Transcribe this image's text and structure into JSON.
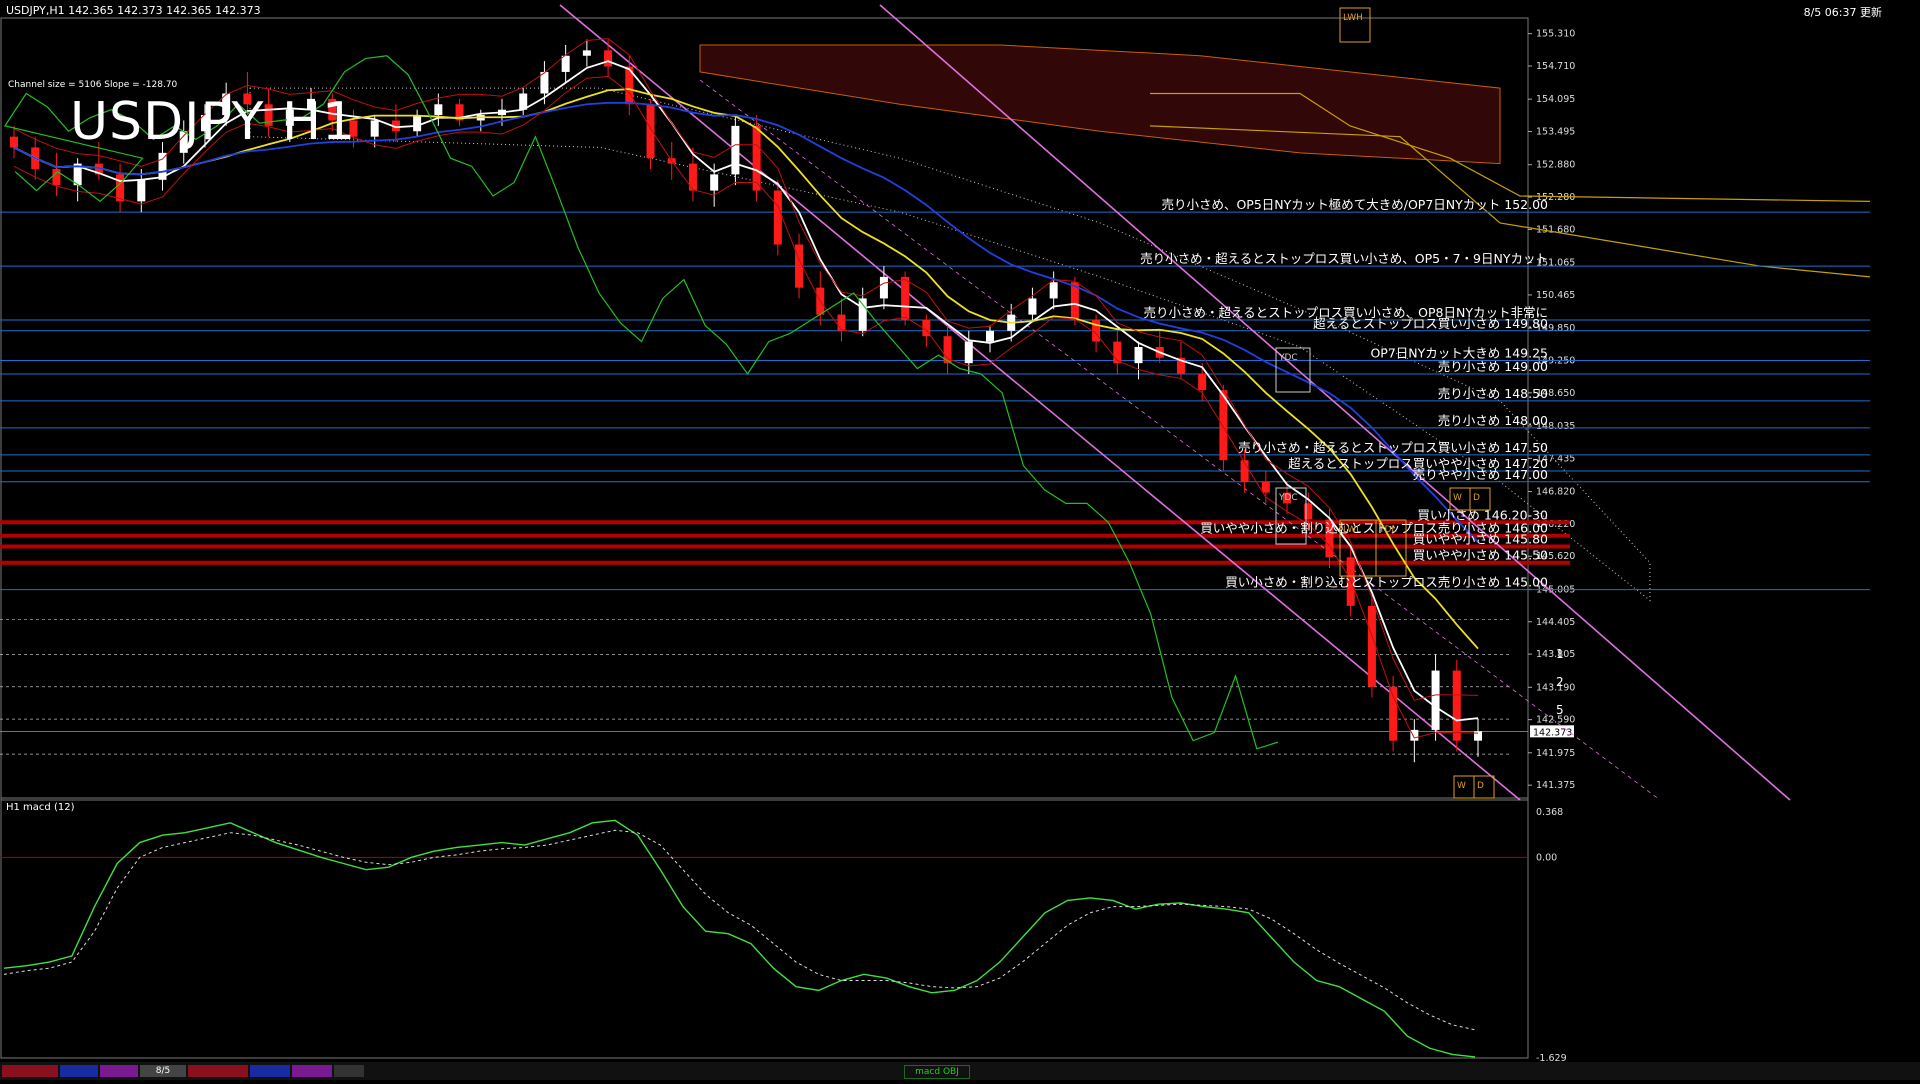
{
  "header": {
    "symbol_info": "USDJPY,H1  142.365 142.373 142.365 142.373",
    "timestamp": "8/5 06:37 更新",
    "channel_info": "Channel size = 5106 Slope = -128.70",
    "big_title": "USDJPY H1",
    "macd_label": "H1  macd (12)",
    "macd_tab": "macd OBJ",
    "date_cell": "8/5"
  },
  "colors": {
    "background": "#000000",
    "up_candle": "#ffffff",
    "down_candle": "#ff1a1a",
    "blue_level": "#1e6fd0",
    "red_zone": "#b40000",
    "channel": "#e070e0",
    "sma_white": "#ffffff",
    "sma_yellow": "#f0e020",
    "sma_blue": "#2040e0",
    "chikou_green": "#22c022",
    "cloud_edge": "#c8a000",
    "macd_green": "#40e040",
    "macd_pink": "#ff8090"
  },
  "chart_data": [
    {
      "type": "candlestick",
      "title": "USDJPY H1",
      "ylim": [
        141.1,
        155.6
      ],
      "y_ticks": [
        "155.310",
        "154.710",
        "154.095",
        "153.495",
        "152.880",
        "152.280",
        "151.680",
        "151.065",
        "150.465",
        "149.850",
        "149.250",
        "148.650",
        "148.035",
        "147.435",
        "146.820",
        "146.220",
        "145.620",
        "145.005",
        "144.405",
        "143.805",
        "143.190",
        "142.590",
        "141.975",
        "141.375"
      ],
      "current_price": "142.373",
      "candles": [
        [
          153.4,
          153.6,
          153.0,
          153.2
        ],
        [
          153.2,
          153.4,
          152.6,
          152.8
        ],
        [
          152.8,
          153.1,
          152.3,
          152.5
        ],
        [
          152.5,
          153.0,
          152.2,
          152.9
        ],
        [
          152.9,
          153.3,
          152.6,
          152.7
        ],
        [
          152.7,
          152.9,
          152.0,
          152.2
        ],
        [
          152.2,
          152.8,
          152.0,
          152.6
        ],
        [
          152.6,
          153.3,
          152.4,
          153.1
        ],
        [
          153.1,
          153.7,
          152.9,
          153.5
        ],
        [
          153.5,
          154.0,
          153.2,
          153.8
        ],
        [
          153.8,
          154.4,
          153.6,
          154.2
        ],
        [
          154.2,
          154.6,
          153.8,
          154.0
        ],
        [
          154.0,
          154.3,
          153.4,
          153.6
        ],
        [
          153.6,
          154.0,
          153.3,
          153.9
        ],
        [
          153.9,
          154.3,
          153.7,
          154.1
        ],
        [
          154.1,
          154.2,
          153.5,
          153.7
        ],
        [
          153.7,
          153.9,
          153.2,
          153.4
        ],
        [
          153.4,
          153.8,
          153.2,
          153.7
        ],
        [
          153.7,
          154.0,
          153.3,
          153.5
        ],
        [
          153.5,
          153.9,
          153.4,
          153.8
        ],
        [
          153.8,
          154.2,
          153.6,
          154.0
        ],
        [
          154.0,
          154.1,
          153.6,
          153.7
        ],
        [
          153.7,
          153.9,
          153.5,
          153.8
        ],
        [
          153.8,
          154.1,
          153.6,
          153.9
        ],
        [
          153.9,
          154.3,
          153.8,
          154.2
        ],
        [
          154.2,
          154.8,
          154.0,
          154.6
        ],
        [
          154.6,
          155.1,
          154.4,
          154.9
        ],
        [
          154.9,
          155.2,
          154.7,
          155.0
        ],
        [
          155.0,
          155.2,
          154.5,
          154.7
        ],
        [
          154.7,
          154.9,
          153.8,
          154.0
        ],
        [
          154.0,
          154.1,
          152.8,
          153.0
        ],
        [
          153.0,
          153.3,
          152.6,
          152.9
        ],
        [
          152.9,
          153.2,
          152.2,
          152.4
        ],
        [
          152.4,
          152.9,
          152.1,
          152.7
        ],
        [
          152.7,
          153.8,
          152.5,
          153.6
        ],
        [
          153.6,
          153.8,
          152.2,
          152.4
        ],
        [
          152.4,
          152.6,
          151.2,
          151.4
        ],
        [
          151.4,
          151.6,
          150.4,
          150.6
        ],
        [
          150.6,
          150.9,
          149.9,
          150.1
        ],
        [
          150.1,
          150.4,
          149.6,
          149.8
        ],
        [
          149.8,
          150.6,
          149.7,
          150.4
        ],
        [
          150.4,
          151.0,
          150.2,
          150.8
        ],
        [
          150.8,
          150.9,
          149.9,
          150.0
        ],
        [
          150.0,
          150.1,
          149.5,
          149.7
        ],
        [
          149.7,
          149.9,
          149.0,
          149.2
        ],
        [
          149.2,
          149.8,
          149.0,
          149.6
        ],
        [
          149.6,
          149.9,
          149.4,
          149.8
        ],
        [
          149.8,
          150.3,
          149.6,
          150.1
        ],
        [
          150.1,
          150.6,
          150.0,
          150.4
        ],
        [
          150.4,
          150.9,
          150.2,
          150.7
        ],
        [
          150.7,
          150.8,
          149.9,
          150.0
        ],
        [
          150.0,
          150.1,
          149.4,
          149.6
        ],
        [
          149.6,
          149.8,
          149.0,
          149.2
        ],
        [
          149.2,
          149.6,
          148.9,
          149.5
        ],
        [
          149.5,
          149.8,
          149.2,
          149.3
        ],
        [
          149.3,
          149.6,
          148.9,
          149.0
        ],
        [
          149.0,
          149.2,
          148.5,
          148.7
        ],
        [
          148.7,
          148.8,
          147.2,
          147.4
        ],
        [
          147.4,
          147.6,
          146.8,
          147.0
        ],
        [
          147.0,
          147.2,
          146.6,
          146.8
        ],
        [
          146.8,
          147.0,
          146.4,
          146.6
        ],
        [
          146.6,
          146.8,
          146.1,
          146.3
        ],
        [
          146.3,
          146.5,
          145.4,
          145.6
        ],
        [
          145.6,
          145.8,
          144.5,
          144.7
        ],
        [
          144.7,
          144.9,
          143.0,
          143.2
        ],
        [
          143.2,
          143.4,
          142.0,
          142.2
        ],
        [
          142.2,
          142.6,
          141.8,
          142.4
        ],
        [
          142.4,
          143.8,
          142.2,
          143.5
        ],
        [
          143.5,
          143.7,
          142.0,
          142.2
        ],
        [
          142.2,
          142.6,
          141.9,
          142.373
        ]
      ],
      "levels": [
        {
          "price": 152.0,
          "label": "売り小さめ、OP5日NYカット極めて大きめ/OP7日NYカット 152.00"
        },
        {
          "price": 151.0,
          "label": "売り小さめ・超えるとストップロス買い小さめ、OP5・7・9日NYカット"
        },
        {
          "price": 150.0,
          "label": "売り小さめ・超えるとストップロス買い小さめ、OP8日NYカット非常に"
        },
        {
          "price": 149.8,
          "label": "超えるとストップロス買い小さめ 149.80"
        },
        {
          "price": 149.25,
          "label": "OP7日NYカット大きめ 149.25"
        },
        {
          "price": 149.0,
          "label": "売り小さめ 149.00"
        },
        {
          "price": 148.5,
          "label": "売り小さめ 148.50"
        },
        {
          "price": 148.0,
          "label": "売り小さめ 148.00"
        },
        {
          "price": 147.5,
          "label": "売り小さめ・超えるとストップロス買い小さめ 147.50"
        },
        {
          "price": 147.2,
          "label": "超えるとストップロス買いやや小さめ 147.20"
        },
        {
          "price": 147.0,
          "label": "売りやや小さめ 147.00"
        },
        {
          "price": 146.25,
          "label": "買い小さめ 146.20-30"
        },
        {
          "price": 146.0,
          "label": "買いやや小さめ・割り込むとストップロス売り小さめ 146.00"
        },
        {
          "price": 145.8,
          "label": "買いやや小さめ 145.80"
        },
        {
          "price": 145.5,
          "label": "買いやや小さめ 145.50"
        },
        {
          "price": 145.0,
          "label": "買い小さめ・割り込むとストップロス売り小さめ 145.00"
        }
      ],
      "box_labels": [
        "LWH",
        "YDC",
        "LWL",
        "YDL",
        "W",
        "D"
      ],
      "fib_marks": [
        "1",
        "2",
        "5"
      ]
    },
    {
      "type": "line",
      "title": "H1  macd (12)",
      "ylim": [
        -1.629,
        0.368
      ],
      "y_ticks": [
        "0.368",
        "0.00",
        "-1.629"
      ],
      "macd": [
        -0.9,
        -0.88,
        -0.85,
        -0.8,
        -0.4,
        -0.05,
        0.12,
        0.18,
        0.2,
        0.24,
        0.28,
        0.2,
        0.12,
        0.06,
        0.0,
        -0.05,
        -0.1,
        -0.08,
        0.0,
        0.05,
        0.08,
        0.1,
        0.12,
        0.1,
        0.15,
        0.2,
        0.28,
        0.3,
        0.18,
        -0.1,
        -0.4,
        -0.6,
        -0.62,
        -0.7,
        -0.9,
        -1.05,
        -1.08,
        -1.0,
        -0.95,
        -0.98,
        -1.05,
        -1.1,
        -1.08,
        -1.0,
        -0.85,
        -0.65,
        -0.45,
        -0.35,
        -0.33,
        -0.35,
        -0.42,
        -0.38,
        -0.37,
        -0.4,
        -0.42,
        -0.45,
        -0.65,
        -0.85,
        -1.0,
        -1.05,
        -1.15,
        -1.25,
        -1.45,
        -1.55,
        -1.6,
        -1.62
      ],
      "signal": [
        -0.95,
        -0.92,
        -0.9,
        -0.85,
        -0.6,
        -0.25,
        0.0,
        0.08,
        0.12,
        0.16,
        0.2,
        0.18,
        0.14,
        0.1,
        0.05,
        0.0,
        -0.04,
        -0.06,
        -0.04,
        0.0,
        0.02,
        0.05,
        0.07,
        0.08,
        0.1,
        0.14,
        0.18,
        0.22,
        0.2,
        0.1,
        -0.1,
        -0.3,
        -0.45,
        -0.55,
        -0.7,
        -0.85,
        -0.95,
        -1.0,
        -1.0,
        -1.0,
        -1.02,
        -1.05,
        -1.06,
        -1.05,
        -0.98,
        -0.85,
        -0.7,
        -0.55,
        -0.45,
        -0.4,
        -0.4,
        -0.39,
        -0.38,
        -0.39,
        -0.4,
        -0.42,
        -0.5,
        -0.62,
        -0.75,
        -0.86,
        -0.96,
        -1.06,
        -1.18,
        -1.28,
        -1.36,
        -1.4
      ]
    }
  ]
}
